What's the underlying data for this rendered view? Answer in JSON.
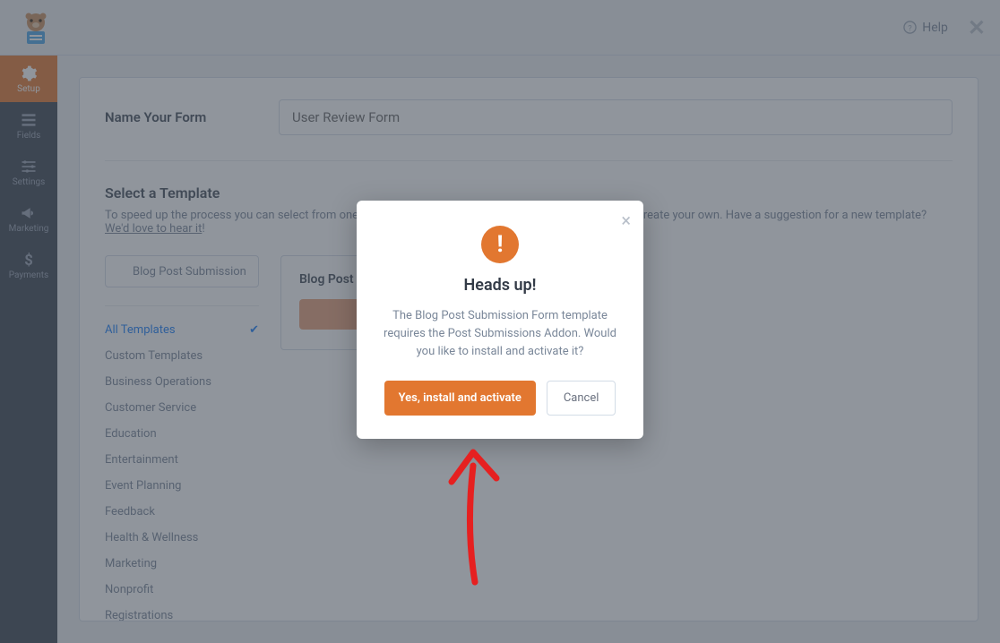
{
  "topbar": {
    "help_label": "Help"
  },
  "sidebar": {
    "items": [
      {
        "label": "Setup"
      },
      {
        "label": "Fields"
      },
      {
        "label": "Settings"
      },
      {
        "label": "Marketing"
      },
      {
        "label": "Payments"
      }
    ]
  },
  "form": {
    "name_label": "Name Your Form",
    "name_value": "User Review Form"
  },
  "templates": {
    "title": "Select a Template",
    "desc_prefix": "To speed up the process you can select from one of our pre-made templates, start with a blank form or create your own. Have a suggestion for a new template? ",
    "desc_link": "We'd love to hear it",
    "desc_suffix": "!",
    "search_value": "Blog Post Submission",
    "categories": [
      "All Templates",
      "Custom Templates",
      "Business Operations",
      "Customer Service",
      "Education",
      "Entertainment",
      "Event Planning",
      "Feedback",
      "Health & Wellness",
      "Marketing",
      "Nonprofit",
      "Registrations"
    ],
    "card": {
      "title": "Blog Post Submission Form"
    }
  },
  "modal": {
    "title": "Heads up!",
    "text": "The Blog Post Submission Form template requires the Post Submissions Addon. Would you like to install and activate it?",
    "confirm": "Yes, install and activate",
    "cancel": "Cancel"
  }
}
